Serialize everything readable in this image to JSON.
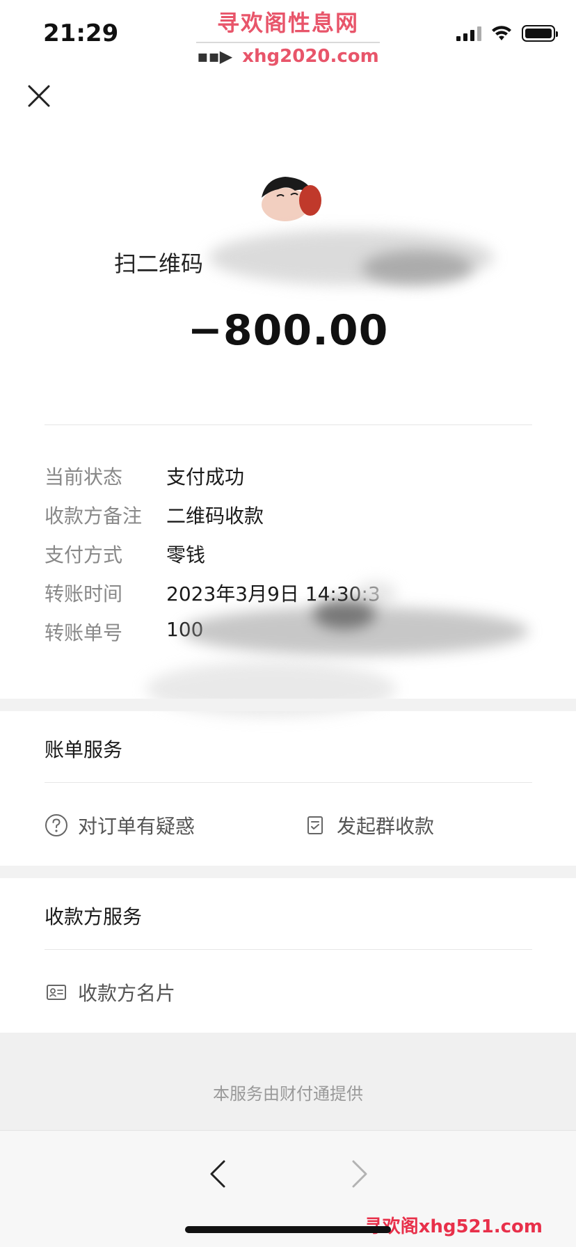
{
  "status_bar": {
    "time": "21:29"
  },
  "watermark_top": {
    "title": "寻欢阁性息网",
    "url": "xhg2020.com"
  },
  "header": {
    "close_icon": "close-icon"
  },
  "transaction": {
    "payee_title": "扫二维码",
    "amount": "−800.00"
  },
  "details": [
    {
      "label": "当前状态",
      "value": "支付成功"
    },
    {
      "label": "收款方备注",
      "value": "二维码收款"
    },
    {
      "label": "支付方式",
      "value": "零钱"
    },
    {
      "label": "转账时间",
      "value": "2023年3月9日 14:30:3"
    },
    {
      "label": "转账单号",
      "value": "100"
    }
  ],
  "bill_service": {
    "title": "账单服务",
    "actions": [
      {
        "label": "对订单有疑惑",
        "icon": "question-circle-icon"
      },
      {
        "label": "发起群收款",
        "icon": "checklist-icon"
      }
    ]
  },
  "payee_service": {
    "title": "收款方服务",
    "actions": [
      {
        "label": "收款方名片",
        "icon": "id-card-icon"
      }
    ]
  },
  "footer": {
    "text": "本服务由财付通提供"
  },
  "watermark_bottom": {
    "text": "寻欢阁xhg521.com"
  }
}
